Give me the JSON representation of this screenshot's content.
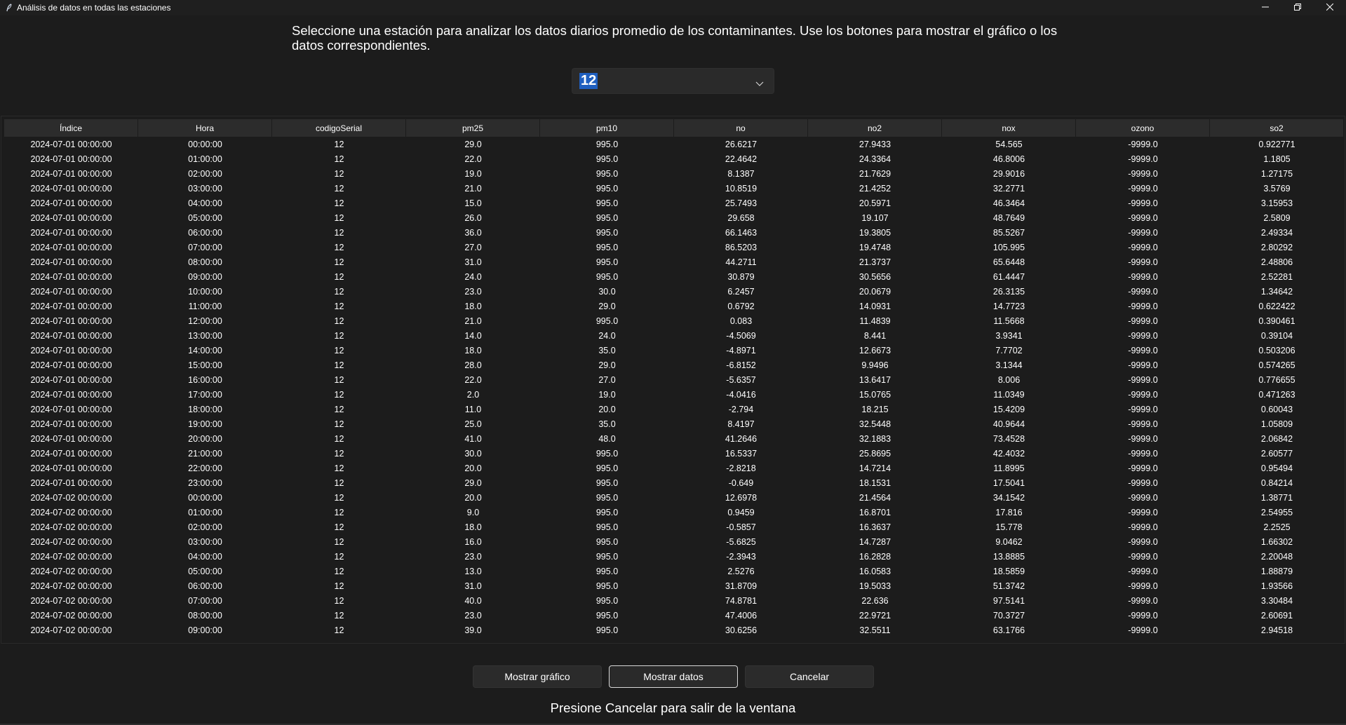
{
  "window": {
    "title": "Análisis de datos en todas las estaciones",
    "icon": "feather-icon",
    "controls": [
      "minimize-icon",
      "restore-icon",
      "close-icon"
    ]
  },
  "instruction": "Seleccione una estación para analizar los datos diarios promedio de los contaminantes. Use los botones para mostrar el gráfico o los datos correspondientes.",
  "station_select": {
    "value": "12"
  },
  "table": {
    "columns": [
      "Índice",
      "Hora",
      "codigoSerial",
      "pm25",
      "pm10",
      "no",
      "no2",
      "nox",
      "ozono",
      "so2"
    ],
    "rows": [
      [
        "2024-07-01 00:00:00",
        "00:00:00",
        "12",
        "29.0",
        "995.0",
        "26.6217",
        "27.9433",
        "54.565",
        "-9999.0",
        "0.922771"
      ],
      [
        "2024-07-01 00:00:00",
        "01:00:00",
        "12",
        "22.0",
        "995.0",
        "22.4642",
        "24.3364",
        "46.8006",
        "-9999.0",
        "1.1805"
      ],
      [
        "2024-07-01 00:00:00",
        "02:00:00",
        "12",
        "19.0",
        "995.0",
        "8.1387",
        "21.7629",
        "29.9016",
        "-9999.0",
        "1.27175"
      ],
      [
        "2024-07-01 00:00:00",
        "03:00:00",
        "12",
        "21.0",
        "995.0",
        "10.8519",
        "21.4252",
        "32.2771",
        "-9999.0",
        "3.5769"
      ],
      [
        "2024-07-01 00:00:00",
        "04:00:00",
        "12",
        "15.0",
        "995.0",
        "25.7493",
        "20.5971",
        "46.3464",
        "-9999.0",
        "3.15953"
      ],
      [
        "2024-07-01 00:00:00",
        "05:00:00",
        "12",
        "26.0",
        "995.0",
        "29.658",
        "19.107",
        "48.7649",
        "-9999.0",
        "2.5809"
      ],
      [
        "2024-07-01 00:00:00",
        "06:00:00",
        "12",
        "36.0",
        "995.0",
        "66.1463",
        "19.3805",
        "85.5267",
        "-9999.0",
        "2.49334"
      ],
      [
        "2024-07-01 00:00:00",
        "07:00:00",
        "12",
        "27.0",
        "995.0",
        "86.5203",
        "19.4748",
        "105.995",
        "-9999.0",
        "2.80292"
      ],
      [
        "2024-07-01 00:00:00",
        "08:00:00",
        "12",
        "31.0",
        "995.0",
        "44.2711",
        "21.3737",
        "65.6448",
        "-9999.0",
        "2.48806"
      ],
      [
        "2024-07-01 00:00:00",
        "09:00:00",
        "12",
        "24.0",
        "995.0",
        "30.879",
        "30.5656",
        "61.4447",
        "-9999.0",
        "2.52281"
      ],
      [
        "2024-07-01 00:00:00",
        "10:00:00",
        "12",
        "23.0",
        "30.0",
        "6.2457",
        "20.0679",
        "26.3135",
        "-9999.0",
        "1.34642"
      ],
      [
        "2024-07-01 00:00:00",
        "11:00:00",
        "12",
        "18.0",
        "29.0",
        "0.6792",
        "14.0931",
        "14.7723",
        "-9999.0",
        "0.622422"
      ],
      [
        "2024-07-01 00:00:00",
        "12:00:00",
        "12",
        "21.0",
        "995.0",
        "0.083",
        "11.4839",
        "11.5668",
        "-9999.0",
        "0.390461"
      ],
      [
        "2024-07-01 00:00:00",
        "13:00:00",
        "12",
        "14.0",
        "24.0",
        "-4.5069",
        "8.441",
        "3.9341",
        "-9999.0",
        "0.39104"
      ],
      [
        "2024-07-01 00:00:00",
        "14:00:00",
        "12",
        "18.0",
        "35.0",
        "-4.8971",
        "12.6673",
        "7.7702",
        "-9999.0",
        "0.503206"
      ],
      [
        "2024-07-01 00:00:00",
        "15:00:00",
        "12",
        "28.0",
        "29.0",
        "-6.8152",
        "9.9496",
        "3.1344",
        "-9999.0",
        "0.574265"
      ],
      [
        "2024-07-01 00:00:00",
        "16:00:00",
        "12",
        "22.0",
        "27.0",
        "-5.6357",
        "13.6417",
        "8.006",
        "-9999.0",
        "0.776655"
      ],
      [
        "2024-07-01 00:00:00",
        "17:00:00",
        "12",
        "2.0",
        "19.0",
        "-4.0416",
        "15.0765",
        "11.0349",
        "-9999.0",
        "0.471263"
      ],
      [
        "2024-07-01 00:00:00",
        "18:00:00",
        "12",
        "11.0",
        "20.0",
        "-2.794",
        "18.215",
        "15.4209",
        "-9999.0",
        "0.60043"
      ],
      [
        "2024-07-01 00:00:00",
        "19:00:00",
        "12",
        "25.0",
        "35.0",
        "8.4197",
        "32.5448",
        "40.9644",
        "-9999.0",
        "1.05809"
      ],
      [
        "2024-07-01 00:00:00",
        "20:00:00",
        "12",
        "41.0",
        "48.0",
        "41.2646",
        "32.1883",
        "73.4528",
        "-9999.0",
        "2.06842"
      ],
      [
        "2024-07-01 00:00:00",
        "21:00:00",
        "12",
        "30.0",
        "995.0",
        "16.5337",
        "25.8695",
        "42.4032",
        "-9999.0",
        "2.60577"
      ],
      [
        "2024-07-01 00:00:00",
        "22:00:00",
        "12",
        "20.0",
        "995.0",
        "-2.8218",
        "14.7214",
        "11.8995",
        "-9999.0",
        "0.95494"
      ],
      [
        "2024-07-01 00:00:00",
        "23:00:00",
        "12",
        "29.0",
        "995.0",
        "-0.649",
        "18.1531",
        "17.5041",
        "-9999.0",
        "0.84214"
      ],
      [
        "2024-07-02 00:00:00",
        "00:00:00",
        "12",
        "20.0",
        "995.0",
        "12.6978",
        "21.4564",
        "34.1542",
        "-9999.0",
        "1.38771"
      ],
      [
        "2024-07-02 00:00:00",
        "01:00:00",
        "12",
        "9.0",
        "995.0",
        "0.9459",
        "16.8701",
        "17.816",
        "-9999.0",
        "2.54955"
      ],
      [
        "2024-07-02 00:00:00",
        "02:00:00",
        "12",
        "18.0",
        "995.0",
        "-0.5857",
        "16.3637",
        "15.778",
        "-9999.0",
        "2.2525"
      ],
      [
        "2024-07-02 00:00:00",
        "03:00:00",
        "12",
        "16.0",
        "995.0",
        "-5.6825",
        "14.7287",
        "9.0462",
        "-9999.0",
        "1.66302"
      ],
      [
        "2024-07-02 00:00:00",
        "04:00:00",
        "12",
        "23.0",
        "995.0",
        "-2.3943",
        "16.2828",
        "13.8885",
        "-9999.0",
        "2.20048"
      ],
      [
        "2024-07-02 00:00:00",
        "05:00:00",
        "12",
        "13.0",
        "995.0",
        "2.5276",
        "16.0583",
        "18.5859",
        "-9999.0",
        "1.88879"
      ],
      [
        "2024-07-02 00:00:00",
        "06:00:00",
        "12",
        "31.0",
        "995.0",
        "31.8709",
        "19.5033",
        "51.3742",
        "-9999.0",
        "1.93566"
      ],
      [
        "2024-07-02 00:00:00",
        "07:00:00",
        "12",
        "40.0",
        "995.0",
        "74.8781",
        "22.636",
        "97.5141",
        "-9999.0",
        "3.30484"
      ],
      [
        "2024-07-02 00:00:00",
        "08:00:00",
        "12",
        "23.0",
        "995.0",
        "47.4006",
        "22.9721",
        "70.3727",
        "-9999.0",
        "2.60691"
      ],
      [
        "2024-07-02 00:00:00",
        "09:00:00",
        "12",
        "39.0",
        "995.0",
        "30.6256",
        "32.5511",
        "63.1766",
        "-9999.0",
        "2.94518"
      ]
    ]
  },
  "buttons": {
    "show_chart": "Mostrar gráfico",
    "show_data": "Mostrar datos",
    "cancel": "Cancelar"
  },
  "footer": "Presione Cancelar para salir de la ventana",
  "colors": {
    "background": "#1c1c1c",
    "selection": "#1f5fbf",
    "header_bg": "#2c2c2c"
  }
}
